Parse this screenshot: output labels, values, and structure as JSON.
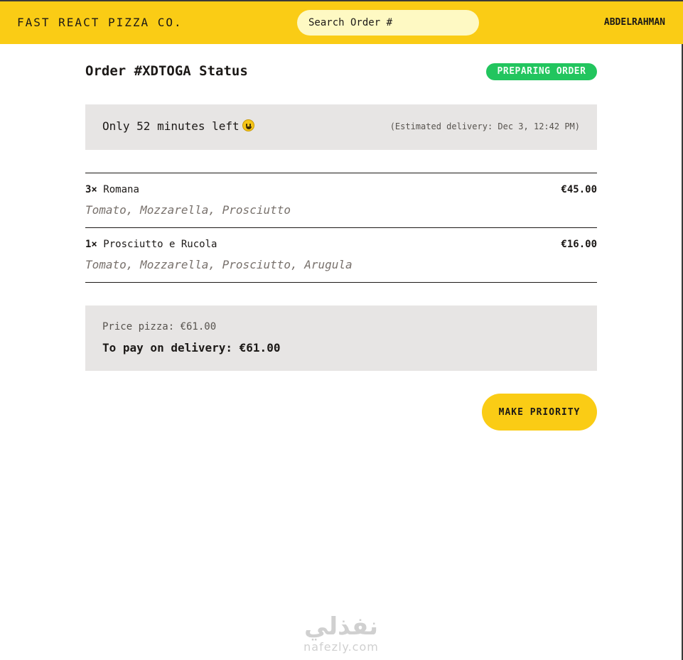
{
  "header": {
    "logo": "FAST REACT PIZZA CO.",
    "search_placeholder": "Search Order #",
    "username": "ABDELRAHMAN"
  },
  "order": {
    "title": "Order #XDTOGA Status",
    "status_badge": "PREPARING ORDER",
    "time_left": "Only 52 minutes left",
    "time_left_emoji": "smiley-face-icon",
    "estimated_delivery": "(Estimated delivery: Dec 3, 12:42 PM)"
  },
  "items": [
    {
      "qty": "3×",
      "name": "Romana",
      "price": "€45.00",
      "ingredients": "Tomato, Mozzarella, Prosciutto"
    },
    {
      "qty": "1×",
      "name": "Prosciutto e Rucola",
      "price": "€16.00",
      "ingredients": "Tomato, Mozzarella, Prosciutto, Arugula"
    }
  ],
  "summary": {
    "price_pizza": "Price pizza: €61.00",
    "to_pay": "To pay on delivery: €61.00"
  },
  "actions": {
    "make_priority": "MAKE PRIORITY"
  },
  "watermark": {
    "arabic": "نفذلي",
    "latin": "nafezly.com"
  },
  "colors": {
    "accent": "#facc15",
    "search_bg": "#fef9c3",
    "status_green": "#22c55e",
    "panel_bg": "#e7e5e4",
    "muted_text": "#78716c"
  }
}
